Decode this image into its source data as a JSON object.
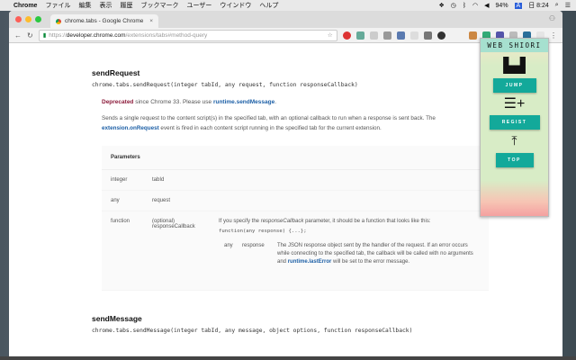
{
  "menubar": {
    "app": "Chrome",
    "items": [
      "ファイル",
      "編集",
      "表示",
      "履歴",
      "ブックマーク",
      "ユーザー",
      "ウインドウ",
      "ヘルプ"
    ],
    "battery": "94%",
    "input": "A",
    "time": "日 8:24"
  },
  "tab": {
    "title": "chrome.tabs - Google Chrome"
  },
  "address": {
    "scheme": "https://",
    "host": "developer.chrome.com",
    "path": "/extensions/tabs#method-query"
  },
  "doc": {
    "title": "sendRequest",
    "signature": "chrome.tabs.sendRequest(integer tabId, any request, function responseCallback)",
    "deprecated_label": "Deprecated",
    "deprecated_text": " since Chrome 33. Please use ",
    "deprecated_link": "runtime.sendMessage",
    "deprecated_end": ".",
    "desc1": "Sends a single request to the content script(s) in the specified tab, with an optional callback to run when a response is sent back. The ",
    "desc_link": "extension.onRequest",
    "desc2": " event is fired in each content script running in the specified tab for the current extension.",
    "params_header": "Parameters",
    "params": [
      {
        "type": "integer",
        "name": "tabId"
      },
      {
        "type": "any",
        "name": "request"
      }
    ],
    "fn": {
      "type": "function",
      "optional": "(optional)",
      "name": "responseCallback",
      "text_a": "If you specify the ",
      "text_em": "responseCallback",
      "text_b": " parameter, it should be a function that looks like this:",
      "code": "function(any response) {...};",
      "sub": {
        "type": "any",
        "name": "response",
        "text_a": "The JSON response object sent by the handler of the request. If an error occurs while connecting to the specified tab, the callback will be called with no arguments and ",
        "link": "runtime.lastError",
        "text_b": " will be set to the error message."
      }
    },
    "title2": "sendMessage",
    "signature2": "chrome.tabs.sendMessage(integer tabId, any message, object options, function responseCallback)"
  },
  "popup": {
    "title": "WEB SHIORI",
    "jump": "JUMP",
    "regist": "REGIST",
    "top": "TOP"
  }
}
